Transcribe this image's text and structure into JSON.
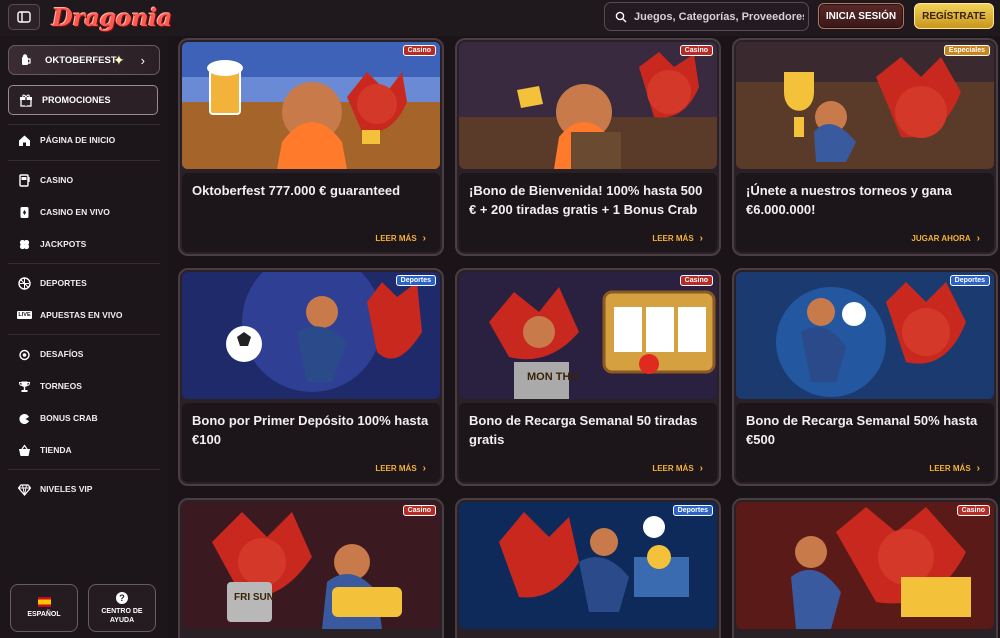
{
  "header": {
    "logo": "Dragonia",
    "search_placeholder": "Juegos, Categorías, Proveedores",
    "login_label": "INICIA SESIÓN",
    "register_label": "REGÍSTRATE"
  },
  "sidebar": {
    "featured_promo": "OKTOBERFEST",
    "promotions_label": "PROMOCIONES",
    "items": [
      {
        "label": "PÁGINA DE INICIO",
        "icon": "home-icon"
      },
      {
        "label": "CASINO",
        "icon": "slot-machine-icon"
      },
      {
        "label": "CASINO EN VIVO",
        "icon": "live-casino-icon"
      },
      {
        "label": "JACKPOTS",
        "icon": "clover-icon"
      },
      {
        "label": "DEPORTES",
        "icon": "ball-icon"
      },
      {
        "label": "APUESTAS EN VIVO",
        "icon": "live-icon"
      },
      {
        "label": "DESAFÍOS",
        "icon": "medal-icon"
      },
      {
        "label": "TORNEOS",
        "icon": "trophy-icon"
      },
      {
        "label": "BONUS CRAB",
        "icon": "crab-icon"
      },
      {
        "label": "TIENDA",
        "icon": "basket-icon"
      },
      {
        "label": "NIVELES VIP",
        "icon": "diamond-icon"
      }
    ],
    "live_tag": "LIVE",
    "language_label": "ESPAÑOL",
    "help_label": "CENTRO DE AYUDA"
  },
  "cards": [
    {
      "badge": "Casino",
      "title": "Oktoberfest 777.000 € guaranteed",
      "cta": "LEER MÁS"
    },
    {
      "badge": "Casino",
      "title": "¡Bono de Bienvenida! 100% hasta 500 € + 200 tiradas gratis + 1 Bonus Crab",
      "cta": "LEER MÁS"
    },
    {
      "badge": "Especiales",
      "title": "¡Únete a nuestros torneos y gana €6.000.000!",
      "cta": "JUGAR AHORA"
    },
    {
      "badge": "Deportes",
      "title": "Bono por Primer Depósito 100% hasta €100",
      "cta": "LEER MÁS"
    },
    {
      "badge": "Casino",
      "title": "Bono de Recarga Semanal 50 tiradas gratis",
      "cta": "LEER MÁS"
    },
    {
      "badge": "Deportes",
      "title": "Bono de Recarga Semanal 50% hasta €500",
      "cta": "LEER MÁS"
    },
    {
      "badge": "Casino",
      "title": "",
      "cta": ""
    },
    {
      "badge": "Deportes",
      "title": "",
      "cta": ""
    },
    {
      "badge": "Casino",
      "title": "",
      "cta": ""
    }
  ],
  "images": {
    "card1_text": "",
    "card5_text": "MON THU",
    "card7_text": "FRI SUN"
  },
  "colors": {
    "accent": "#f5b13a",
    "casino_badge": "#b82a24",
    "deportes_badge": "#2a62c8",
    "especiales_badge": "#c8841a"
  }
}
